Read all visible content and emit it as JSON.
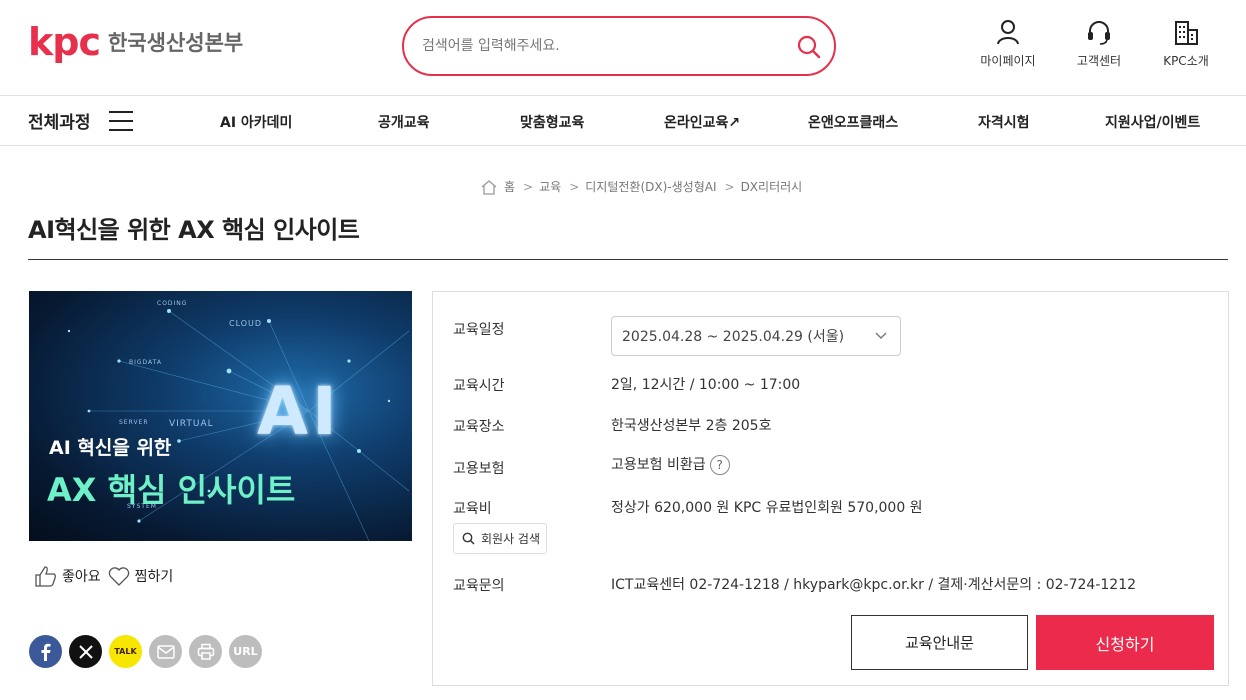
{
  "header": {
    "logo_mark": "kpc",
    "logo_text": "한국생산성본부",
    "search_placeholder": "검색어를 입력해주세요.",
    "utils": [
      {
        "label": "마이페이지",
        "icon": "user-icon"
      },
      {
        "label": "고객센터",
        "icon": "headset-icon"
      },
      {
        "label": "KPC소개",
        "icon": "building-icon"
      }
    ]
  },
  "nav": {
    "all_label": "전체과정",
    "items": [
      "AI 아카데미",
      "공개교육",
      "맞춤형교육",
      "온라인교육↗",
      "온앤오프클래스",
      "자격시험",
      "지원사업/이벤트"
    ]
  },
  "breadcrumb": [
    "홈",
    "교육",
    "디지털전환(DX)-생성형AI",
    "DX리터러시"
  ],
  "page_title": "AI혁신을 위한 AX 핵심 인사이트",
  "banner": {
    "ai_text": "AI",
    "subtitle": "AI 혁신을 위한",
    "main": "AX 핵심 인사이트",
    "words": [
      "CODING",
      "CLOUD",
      "BIGDATA",
      "SERVER",
      "VIRTUAL",
      "SYSTEM"
    ]
  },
  "actions": {
    "like_label": "좋아요",
    "wish_label": "찜하기",
    "share": [
      {
        "icon": "facebook-icon",
        "color": "#3b5998"
      },
      {
        "icon": "x-icon",
        "color": "#111111"
      },
      {
        "icon": "kakaotalk-icon",
        "color": "#f7e600",
        "text": "TALK"
      },
      {
        "icon": "mail-icon",
        "color": "#bdbdbd"
      },
      {
        "icon": "print-icon",
        "color": "#bdbdbd"
      },
      {
        "icon": "url-icon",
        "color": "#bdbdbd",
        "text": "URL"
      }
    ]
  },
  "info": {
    "schedule_label": "교육일정",
    "schedule_value": "2025.04.28 ~ 2025.04.29 (서울)",
    "time_label": "교육시간",
    "time_value": "2일, 12시간 / 10:00 ~ 17:00",
    "place_label": "교육장소",
    "place_value": "한국생산성본부 2층 205호",
    "insurance_label": "고용보험",
    "insurance_value": "고용보험 비환급",
    "fee_label": "교육비",
    "fee_value": "정상가 620,000 원  KPC 유료법인회원 570,000 원",
    "member_search": "회원사 검색",
    "contact_label": "교육문의",
    "contact_value": "ICT교육센터 02-724-1218 / hkypark@kpc.or.kr / 결제·계산서문의 : 02-724-1212"
  },
  "buttons": {
    "guide": "교육안내문",
    "apply": "신청하기"
  },
  "colors": {
    "accent": "#e6304c",
    "apply": "#ec2a4b"
  }
}
